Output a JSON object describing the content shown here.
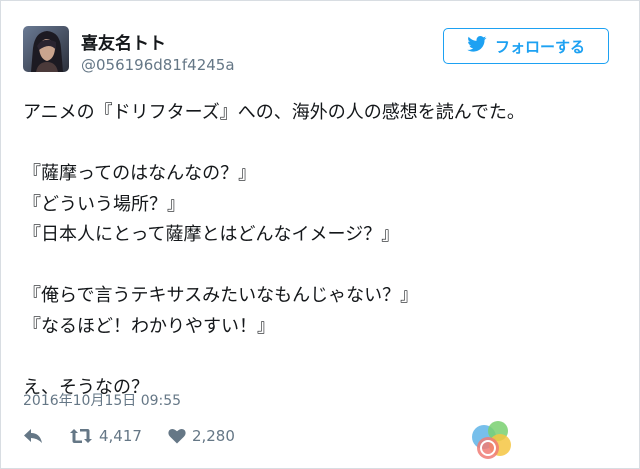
{
  "user": {
    "display_name": "喜友名トト",
    "handle": "@056196d81f4245a"
  },
  "follow_button": {
    "label": "フォローする",
    "icon": "twitter-bird-icon"
  },
  "tweet": {
    "lines": [
      "アニメの『ドリフターズ』への、海外の人の感想を読んでた。",
      "",
      "『薩摩ってのはなんなの？』",
      "『どういう場所？』",
      "『日本人にとって薩摩とはどんなイメージ？』",
      "",
      "『俺らで言うテキサスみたいなもんじゃない？』",
      "『なるほど！わかりやすい！』",
      "",
      "え、そうなの？"
    ],
    "timestamp": "2016年10月15日 09:55"
  },
  "actions": {
    "reply_icon": "reply-icon",
    "retweet_icon": "retweet-icon",
    "retweet_count": "4,417",
    "like_icon": "heart-icon",
    "like_count": "2,280"
  },
  "colors": {
    "accent": "#1da1f2",
    "text": "#14171a",
    "muted": "#657786"
  }
}
